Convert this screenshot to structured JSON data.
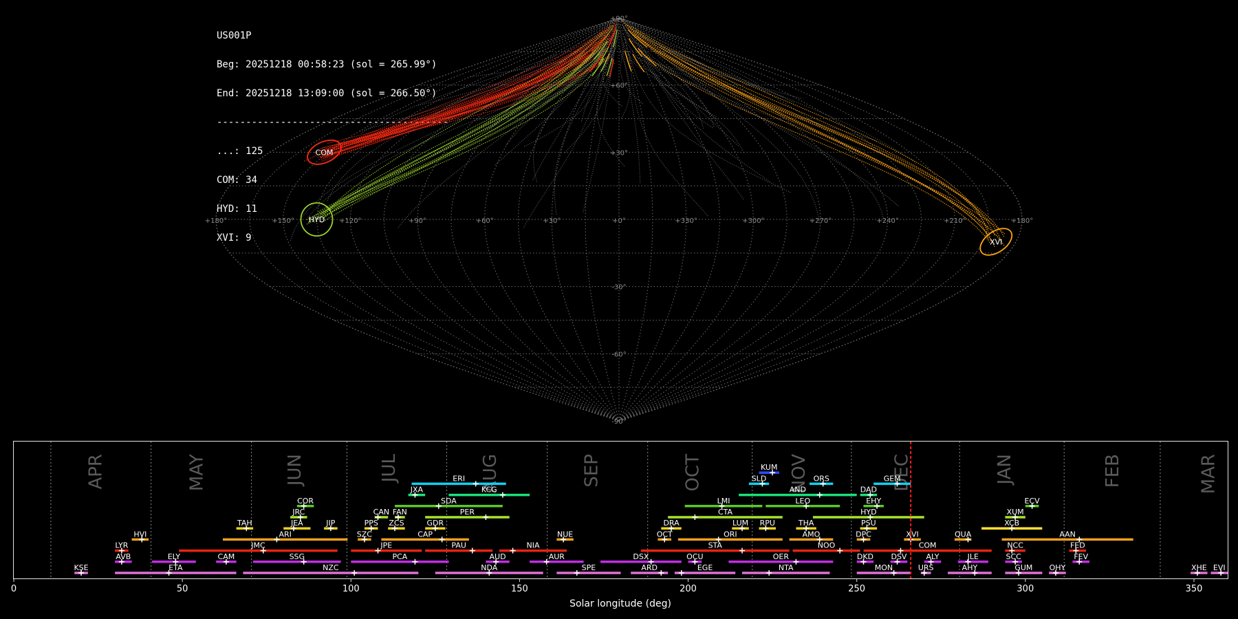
{
  "info": {
    "station": "US001P",
    "begin": "Beg: 20251218 00:58:23 (sol = 265.99°)",
    "end": "End: 20251218 13:09:00 (sol = 266.50°)",
    "separator": "----------------------------------------",
    "counts": [
      {
        "label": "...: 125"
      },
      {
        "label": "COM: 34"
      },
      {
        "label": "HYD: 11"
      },
      {
        "label": "XVI: 9"
      }
    ]
  },
  "sky_map": {
    "projection": "sinusoidal",
    "lon_ticks": [
      "+180°",
      "+150°",
      "+120°",
      "+90°",
      "+60°",
      "+30°",
      "+0°",
      "+330°",
      "+300°",
      "+270°",
      "+240°",
      "+210°",
      "+180°"
    ],
    "lat_ticks": [
      {
        "lat": 90,
        "label": "+90°"
      },
      {
        "lat": 60,
        "label": "+60°"
      },
      {
        "lat": 30,
        "label": "+30°"
      },
      {
        "lat": -30,
        "label": "-30°"
      },
      {
        "lat": -60,
        "label": "-60°"
      },
      {
        "lat": -90,
        "label": "-90°"
      }
    ],
    "radiants": [
      {
        "name": "COM",
        "lon": 152,
        "lat": 30,
        "color": "#ff2a12"
      },
      {
        "name": "HYD",
        "lon": 135,
        "lat": 0,
        "color": "#9bd22e"
      },
      {
        "name": "XVI",
        "lon": 189,
        "lat": -10,
        "color": "#ffa514"
      }
    ],
    "sporadic_color": "#909090"
  },
  "chart_data": {
    "type": "bar",
    "xlabel": "Solar longitude (deg)",
    "xlim": [
      0,
      360
    ],
    "xticks": [
      0,
      50,
      100,
      150,
      200,
      250,
      300,
      350
    ],
    "current_sol": 266.0,
    "months": [
      {
        "name": "APR",
        "start": 11.0,
        "center": 24.5
      },
      {
        "name": "MAY",
        "start": 40.7,
        "center": 54.5
      },
      {
        "name": "JUN",
        "start": 70.5,
        "center": 83.5
      },
      {
        "name": "JUL",
        "start": 98.8,
        "center": 111.5
      },
      {
        "name": "AUG",
        "start": 128.4,
        "center": 141.5
      },
      {
        "name": "SEP",
        "start": 158.2,
        "center": 171.5
      },
      {
        "name": "OCT",
        "start": 188.0,
        "center": 201.5
      },
      {
        "name": "NOV",
        "start": 219.0,
        "center": 233.0
      },
      {
        "name": "DEC",
        "start": 248.4,
        "center": 263.5
      },
      {
        "name": "JAN",
        "start": 280.5,
        "center": 294.0
      },
      {
        "name": "FEB",
        "start": 311.5,
        "center": 326.0
      },
      {
        "name": "MAR",
        "start": 340.0,
        "center": 354.5
      }
    ],
    "showers": [
      {
        "code": "KUM",
        "row": 9,
        "start": 221,
        "end": 227,
        "peak": 225,
        "color": "#2d4bff"
      },
      {
        "code": "ERI",
        "row": 8,
        "start": 118,
        "end": 146,
        "peak": 137,
        "color": "#12d0f0"
      },
      {
        "code": "SLD",
        "row": 8,
        "start": 218,
        "end": 224,
        "peak": 222,
        "color": "#12d0f0"
      },
      {
        "code": "ORS",
        "row": 8,
        "start": 236,
        "end": 243,
        "peak": 240,
        "color": "#12d0f0"
      },
      {
        "code": "GEM",
        "row": 8,
        "start": 255,
        "end": 266,
        "peak": 262,
        "color": "#12d0f0"
      },
      {
        "code": "JXA",
        "row": 7,
        "start": 117,
        "end": 122,
        "peak": 119,
        "color": "#19e27a"
      },
      {
        "code": "KCG",
        "row": 7,
        "start": 129,
        "end": 153,
        "peak": 145,
        "color": "#19e27a"
      },
      {
        "code": "AND",
        "row": 7,
        "start": 215,
        "end": 250,
        "peak": 239,
        "color": "#19e27a"
      },
      {
        "code": "DAD",
        "row": 7,
        "start": 251,
        "end": 256,
        "peak": 254,
        "color": "#19e27a"
      },
      {
        "code": "COR",
        "row": 6,
        "start": 84,
        "end": 89,
        "peak": 86,
        "color": "#5cc822"
      },
      {
        "code": "SDA",
        "row": 6,
        "start": 113,
        "end": 145,
        "peak": 126,
        "color": "#5cc822"
      },
      {
        "code": "LMI",
        "row": 6,
        "start": 199,
        "end": 222,
        "peak": 210,
        "color": "#5cc822"
      },
      {
        "code": "LEO",
        "row": 6,
        "start": 223,
        "end": 245,
        "peak": 235,
        "color": "#5cc822"
      },
      {
        "code": "EHY",
        "row": 6,
        "start": 252,
        "end": 258,
        "peak": 256,
        "color": "#5cc822"
      },
      {
        "code": "ECV",
        "row": 6,
        "start": 300,
        "end": 304,
        "peak": 302,
        "color": "#5cc822"
      },
      {
        "code": "JRC",
        "row": 5,
        "start": 82,
        "end": 87,
        "peak": 85,
        "color": "#a8e22a"
      },
      {
        "code": "CAN",
        "row": 5,
        "start": 107,
        "end": 111,
        "peak": 108,
        "color": "#a8e22a"
      },
      {
        "code": "FAN",
        "row": 5,
        "start": 113,
        "end": 116,
        "peak": 114,
        "color": "#a8e22a"
      },
      {
        "code": "PER",
        "row": 5,
        "start": 122,
        "end": 147,
        "peak": 140,
        "color": "#a8e22a"
      },
      {
        "code": "CTA",
        "row": 5,
        "start": 194,
        "end": 228,
        "peak": 202,
        "color": "#a8e22a"
      },
      {
        "code": "HYD",
        "row": 5,
        "start": 237,
        "end": 270,
        "peak": 254,
        "color": "#a8e22a"
      },
      {
        "code": "XUM",
        "row": 5,
        "start": 294,
        "end": 300,
        "peak": 297,
        "color": "#a8e22a"
      },
      {
        "code": "TAH",
        "row": 4,
        "start": 66,
        "end": 71,
        "peak": 69,
        "color": "#e8d020"
      },
      {
        "code": "JEA",
        "row": 4,
        "start": 80,
        "end": 88,
        "peak": 83,
        "color": "#e8d020"
      },
      {
        "code": "JIP",
        "row": 4,
        "start": 92,
        "end": 96,
        "peak": 94,
        "color": "#e8d020"
      },
      {
        "code": "PPS",
        "row": 4,
        "start": 104,
        "end": 108,
        "peak": 106,
        "color": "#e8d020"
      },
      {
        "code": "ZCS",
        "row": 4,
        "start": 111,
        "end": 116,
        "peak": 113,
        "color": "#e8d020"
      },
      {
        "code": "GDR",
        "row": 4,
        "start": 122,
        "end": 128,
        "peak": 125,
        "color": "#e8d020"
      },
      {
        "code": "DRA",
        "row": 4,
        "start": 192,
        "end": 198,
        "peak": 195,
        "color": "#e8d020"
      },
      {
        "code": "LUM",
        "row": 4,
        "start": 213,
        "end": 218,
        "peak": 216,
        "color": "#e8d020"
      },
      {
        "code": "RPU",
        "row": 4,
        "start": 221,
        "end": 226,
        "peak": 223,
        "color": "#e8d020"
      },
      {
        "code": "THA",
        "row": 4,
        "start": 232,
        "end": 238,
        "peak": 235,
        "color": "#e8d020"
      },
      {
        "code": "PSU",
        "row": 4,
        "start": 251,
        "end": 256,
        "peak": 253,
        "color": "#e8d020"
      },
      {
        "code": "XCB",
        "row": 4,
        "start": 287,
        "end": 305,
        "peak": 296,
        "color": "#ffe033"
      },
      {
        "code": "HVI",
        "row": 3,
        "start": 35,
        "end": 40,
        "peak": 38,
        "color": "#f0a020"
      },
      {
        "code": "ARI",
        "row": 3,
        "start": 62,
        "end": 99,
        "peak": 78,
        "color": "#f0a020"
      },
      {
        "code": "SZC",
        "row": 3,
        "start": 102,
        "end": 106,
        "peak": 104,
        "color": "#f0a020"
      },
      {
        "code": "CAP",
        "row": 3,
        "start": 109,
        "end": 135,
        "peak": 127,
        "color": "#f0a020"
      },
      {
        "code": "NUE",
        "row": 3,
        "start": 161,
        "end": 166,
        "peak": 163,
        "color": "#f0a020"
      },
      {
        "code": "OCT",
        "row": 3,
        "start": 191,
        "end": 195,
        "peak": 193,
        "color": "#f0a020"
      },
      {
        "code": "ORI",
        "row": 3,
        "start": 197,
        "end": 228,
        "peak": 209,
        "color": "#f0a020"
      },
      {
        "code": "AMO",
        "row": 3,
        "start": 230,
        "end": 243,
        "peak": 239,
        "color": "#f0a020"
      },
      {
        "code": "DPC",
        "row": 3,
        "start": 250,
        "end": 254,
        "peak": 252,
        "color": "#f0a020"
      },
      {
        "code": "XVI",
        "row": 3,
        "start": 264,
        "end": 269,
        "peak": 266,
        "color": "#f0a020"
      },
      {
        "code": "QUA",
        "row": 3,
        "start": 279,
        "end": 284,
        "peak": 283,
        "color": "#f0a020"
      },
      {
        "code": "AAN",
        "row": 3,
        "start": 293,
        "end": 332,
        "peak": 316,
        "color": "#f0a020"
      },
      {
        "code": "LYR",
        "row": 2,
        "start": 30,
        "end": 34,
        "peak": 32,
        "color": "#e82410"
      },
      {
        "code": "JMC",
        "row": 2,
        "start": 49,
        "end": 96,
        "peak": 74,
        "color": "#e82410"
      },
      {
        "code": "JPE",
        "row": 2,
        "start": 100,
        "end": 121,
        "peak": 108,
        "color": "#e82410"
      },
      {
        "code": "PAU",
        "row": 2,
        "start": 122,
        "end": 142,
        "peak": 136,
        "color": "#e82410"
      },
      {
        "code": "NIA",
        "row": 2,
        "start": 144,
        "end": 164,
        "peak": 148,
        "color": "#e82410"
      },
      {
        "code": "STA",
        "row": 2,
        "start": 186,
        "end": 230,
        "peak": 216,
        "color": "#e82410"
      },
      {
        "code": "NOO",
        "row": 2,
        "start": 231,
        "end": 251,
        "peak": 245,
        "color": "#e82410"
      },
      {
        "code": "COM",
        "row": 2,
        "start": 252,
        "end": 290,
        "peak": 263,
        "color": "#e82410"
      },
      {
        "code": "NCC",
        "row": 2,
        "start": 294,
        "end": 300,
        "peak": 296,
        "color": "#e82410"
      },
      {
        "code": "FED",
        "row": 2,
        "start": 313,
        "end": 318,
        "peak": 315,
        "color": "#e82410"
      },
      {
        "code": "AVB",
        "row": 1,
        "start": 30,
        "end": 35,
        "peak": 32,
        "color": "#c02ee0"
      },
      {
        "code": "ELY",
        "row": 1,
        "start": 41,
        "end": 54,
        "peak": 48,
        "color": "#c02ee0"
      },
      {
        "code": "CAM",
        "row": 1,
        "start": 60,
        "end": 66,
        "peak": 63,
        "color": "#c02ee0"
      },
      {
        "code": "SSG",
        "row": 1,
        "start": 71,
        "end": 97,
        "peak": 86,
        "color": "#c02ee0"
      },
      {
        "code": "PCA",
        "row": 1,
        "start": 100,
        "end": 129,
        "peak": 119,
        "color": "#c02ee0"
      },
      {
        "code": "AUD",
        "row": 1,
        "start": 140,
        "end": 147,
        "peak": 143,
        "color": "#c02ee0"
      },
      {
        "code": "AUR",
        "row": 1,
        "start": 153,
        "end": 169,
        "peak": 158,
        "color": "#c02ee0"
      },
      {
        "code": "DSX",
        "row": 1,
        "start": 174,
        "end": 198,
        "peak": 189,
        "color": "#c02ee0"
      },
      {
        "code": "OCU",
        "row": 1,
        "start": 200,
        "end": 204,
        "peak": 202,
        "color": "#c02ee0"
      },
      {
        "code": "OER",
        "row": 1,
        "start": 212,
        "end": 243,
        "peak": 232,
        "color": "#c02ee0"
      },
      {
        "code": "DKD",
        "row": 1,
        "start": 250,
        "end": 255,
        "peak": 252,
        "color": "#c02ee0"
      },
      {
        "code": "DSV",
        "row": 1,
        "start": 260,
        "end": 265,
        "peak": 262,
        "color": "#c02ee0"
      },
      {
        "code": "ALY",
        "row": 1,
        "start": 270,
        "end": 275,
        "peak": 272,
        "color": "#c02ee0"
      },
      {
        "code": "JLE",
        "row": 1,
        "start": 280,
        "end": 289,
        "peak": 283,
        "color": "#c02ee0"
      },
      {
        "code": "SCC",
        "row": 1,
        "start": 294,
        "end": 299,
        "peak": 297,
        "color": "#c02ee0"
      },
      {
        "code": "FEV",
        "row": 1,
        "start": 314,
        "end": 319,
        "peak": 316,
        "color": "#c02ee0"
      },
      {
        "code": "KSE",
        "row": 0,
        "start": 18,
        "end": 22,
        "peak": 20,
        "color": "#e070d8"
      },
      {
        "code": "ETA",
        "row": 0,
        "start": 30,
        "end": 66,
        "peak": 46,
        "color": "#e070d8"
      },
      {
        "code": "NZC",
        "row": 0,
        "start": 68,
        "end": 120,
        "peak": 101,
        "color": "#e070d8"
      },
      {
        "code": "NDA",
        "row": 0,
        "start": 125,
        "end": 157,
        "peak": 141,
        "color": "#e070d8"
      },
      {
        "code": "SPE",
        "row": 0,
        "start": 161,
        "end": 180,
        "peak": 167,
        "color": "#e070d8"
      },
      {
        "code": "ARD",
        "row": 0,
        "start": 183,
        "end": 194,
        "peak": 192,
        "color": "#e070d8"
      },
      {
        "code": "EGE",
        "row": 0,
        "start": 196,
        "end": 214,
        "peak": 198,
        "color": "#e070d8"
      },
      {
        "code": "NTA",
        "row": 0,
        "start": 216,
        "end": 242,
        "peak": 224,
        "color": "#e070d8"
      },
      {
        "code": "MON",
        "row": 0,
        "start": 250,
        "end": 266,
        "peak": 261,
        "color": "#e070d8"
      },
      {
        "code": "URS",
        "row": 0,
        "start": 269,
        "end": 272,
        "peak": 270,
        "color": "#e070d8"
      },
      {
        "code": "AHY",
        "row": 0,
        "start": 277,
        "end": 290,
        "peak": 285,
        "color": "#e070d8"
      },
      {
        "code": "GUM",
        "row": 0,
        "start": 294,
        "end": 305,
        "peak": 298,
        "color": "#e070d8"
      },
      {
        "code": "OHY",
        "row": 0,
        "start": 307,
        "end": 312,
        "peak": 309,
        "color": "#e070d8"
      },
      {
        "code": "XHE",
        "row": 0,
        "start": 349,
        "end": 354,
        "peak": 351,
        "color": "#e070d8"
      },
      {
        "code": "EVI",
        "row": 0,
        "start": 355,
        "end": 360,
        "peak": 358,
        "color": "#e070d8"
      }
    ]
  }
}
